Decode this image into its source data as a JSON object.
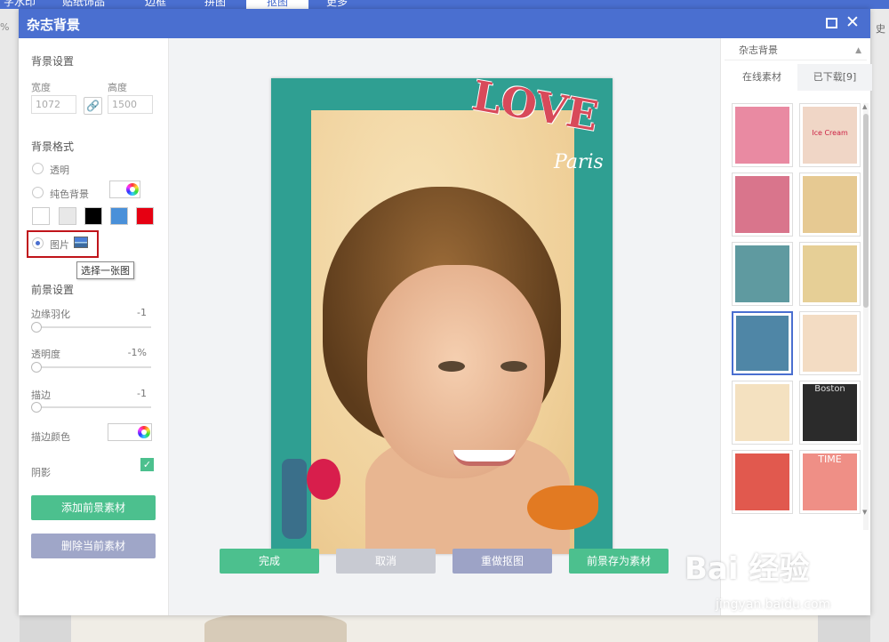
{
  "background": {
    "tabs": [
      "字水印",
      "贴纸饰品",
      "边框",
      "拼图",
      "抠图",
      "更多"
    ],
    "left_text": "%",
    "right_text": "史"
  },
  "dialog": {
    "title": "杂志背景"
  },
  "left": {
    "bg_settings_title": "背景设置",
    "width_label": "宽度",
    "height_label": "高度",
    "width_value": "1072",
    "height_value": "1500",
    "bg_style_title": "背景格式",
    "radio_transparent": "透明",
    "radio_solid": "纯色背景",
    "radio_image": "图片",
    "tooltip": "选择一张图",
    "swatches": [
      "#ffffff",
      "#e8e8e8",
      "#000000",
      "#4a90d9",
      "#e60012"
    ],
    "fg_settings_title": "前景设置",
    "feather_label": "边缘羽化",
    "feather_value": "-1",
    "opacity_label": "透明度",
    "opacity_value": "-1%",
    "stroke_label": "描边",
    "stroke_value": "-1",
    "stroke_color_label": "描边颜色",
    "shadow_label": "阴影",
    "add_fg_button": "添加前景素材",
    "delete_fg_button": "删除当前素材"
  },
  "canvas": {
    "love_text": "LOVE",
    "paris_text": "Paris",
    "buttons": {
      "done": "完成",
      "cancel": "取消",
      "redo": "重做抠图",
      "save_fg": "前景存为素材"
    }
  },
  "right": {
    "select_value": "杂志背景",
    "tab_online": "在线素材",
    "tab_downloaded": "已下载[9]",
    "thumbnails": [
      {
        "label": "",
        "color": "#e98aa2"
      },
      {
        "label": "Ice Cream",
        "color": "#f0d6c6"
      },
      {
        "label": "",
        "color": "#d9758c"
      },
      {
        "label": "",
        "color": "#e6c992"
      },
      {
        "label": "",
        "color": "#5f9aa0"
      },
      {
        "label": "",
        "color": "#e6cf96"
      },
      {
        "label": "",
        "color": "#4f86a6"
      },
      {
        "label": "",
        "color": "#f3dcc3"
      },
      {
        "label": "",
        "color": "#f4e1c0"
      },
      {
        "label": "Boston",
        "color": "#2b2b2b"
      },
      {
        "label": "",
        "color": "#e1594e"
      },
      {
        "label": "TIME",
        "color": "#ef8f86"
      }
    ]
  },
  "watermark": {
    "text": "Bai 经验",
    "sub": "jingyan.baidu.com"
  }
}
